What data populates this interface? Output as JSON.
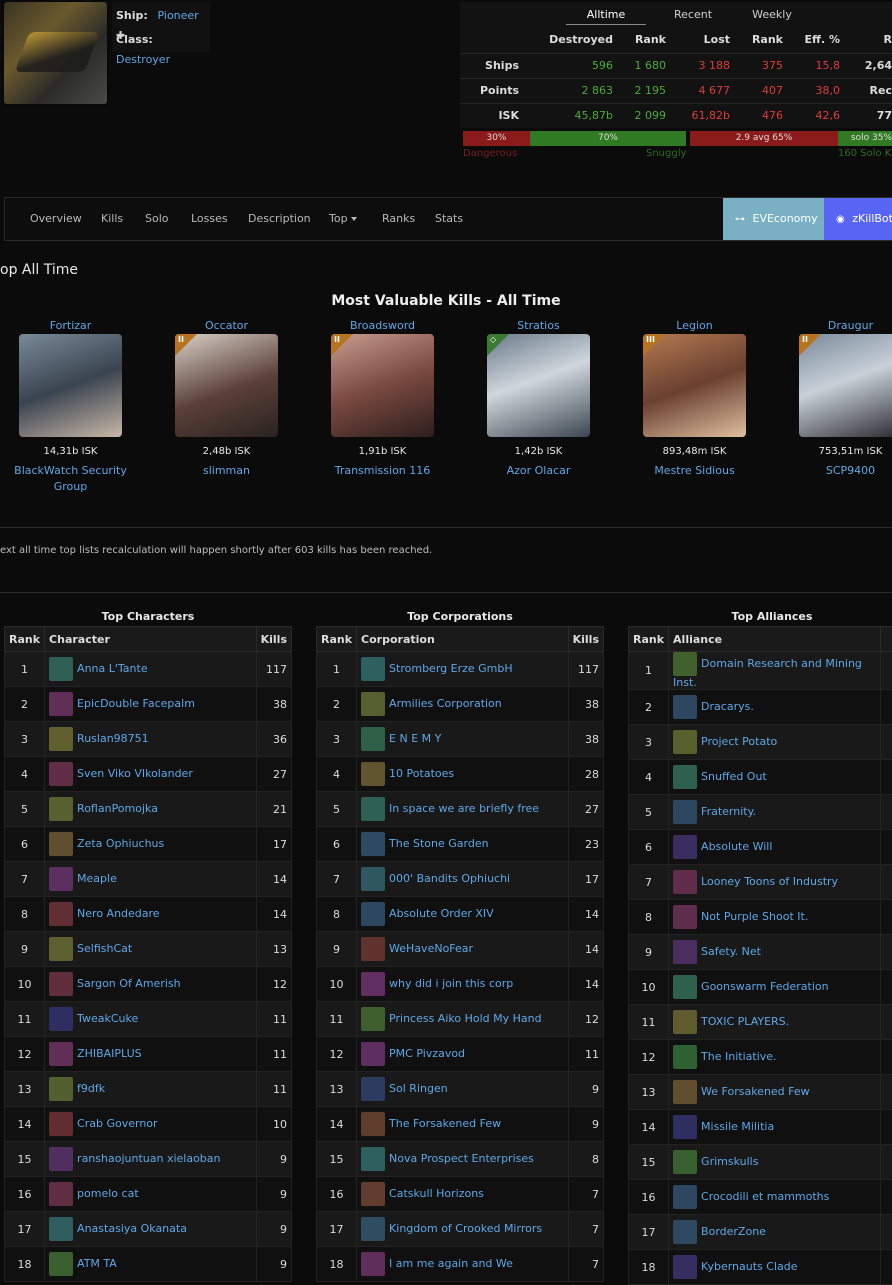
{
  "ship": {
    "label": "Ship:",
    "name": "Pioneer",
    "plus": "✚",
    "class_label": "Class:",
    "class": "Destroyer"
  },
  "stats": {
    "tabs": [
      "Alltime",
      "Recent",
      "Weekly"
    ],
    "headers": [
      "Destroyed",
      "Rank",
      "Lost",
      "Rank",
      "Eff. %",
      "R"
    ],
    "rows": [
      {
        "label": "Ships",
        "destroyed": "596",
        "rank": "1 680",
        "lost": "3 188",
        "lrank": "375",
        "eff": "15,8",
        "extra": "2,64"
      },
      {
        "label": "Points",
        "destroyed": "2 863",
        "rank": "2 195",
        "lost": "4 677",
        "lrank": "407",
        "eff": "38,0",
        "extra": "Rec"
      },
      {
        "label": "ISK",
        "destroyed": "45,87b",
        "rank": "2 099",
        "lost": "61,82b",
        "lrank": "476",
        "eff": "42,6",
        "extra": "77"
      }
    ],
    "bars": {
      "danger_pct": "30%",
      "snuggly_pct": "70%",
      "avg": "2.9 avg 65%",
      "solo": "solo 35%",
      "danger_label": "Dangerous",
      "snuggly_label": "Snuggly",
      "solo_kills": "160 Solo K"
    },
    "bar_levels": {
      "dangerous": 0.3,
      "snuggly": 0.7,
      "gang": 0.65,
      "solo": 0.35
    }
  },
  "nav": {
    "items": [
      "Overview",
      "Kills",
      "Solo",
      "Losses",
      "Description",
      "Top",
      "Ranks",
      "Stats"
    ],
    "eco_label": "EVEconomy",
    "bot_label": "zKillBot"
  },
  "top_title": "op All Time",
  "mvk": {
    "title": "Most Valuable Kills - All Time",
    "kills": [
      {
        "ship": "Fortizar",
        "isk": "14,31b ISK",
        "who": "BlackWatch Security Group",
        "tier": ""
      },
      {
        "ship": "Occator",
        "isk": "2,48b ISK",
        "who": "slimman",
        "tier": "II"
      },
      {
        "ship": "Broadsword",
        "isk": "1,91b ISK",
        "who": "Transmission 116",
        "tier": "II"
      },
      {
        "ship": "Stratios",
        "isk": "1,42b ISK",
        "who": "Azor Olacar",
        "tier": "◇"
      },
      {
        "ship": "Legion",
        "isk": "893,48m ISK",
        "who": "Mestre Sidious",
        "tier": "III"
      },
      {
        "ship": "Draugur",
        "isk": "753,51m ISK",
        "who": "SCP9400",
        "tier": "II"
      }
    ]
  },
  "note": "ext all time top lists recalculation will happen shortly after 603 kills has been reached.",
  "chars": {
    "title": "Top Characters",
    "h_rank": "Rank",
    "h_name": "Character",
    "h_kills": "Kills",
    "rows": [
      {
        "r": "1",
        "n": "Anna L'Tante",
        "k": "117"
      },
      {
        "r": "2",
        "n": "EpicDouble Facepalm",
        "k": "38"
      },
      {
        "r": "3",
        "n": "Ruslan98751",
        "k": "36"
      },
      {
        "r": "4",
        "n": "Sven Viko VIkolander",
        "k": "27"
      },
      {
        "r": "5",
        "n": "RoflanPomojka",
        "k": "21"
      },
      {
        "r": "6",
        "n": "Zeta Ophiuchus",
        "k": "17"
      },
      {
        "r": "7",
        "n": "Meaple",
        "k": "14"
      },
      {
        "r": "8",
        "n": "Nero Andedare",
        "k": "14"
      },
      {
        "r": "9",
        "n": "SelfishCat",
        "k": "13"
      },
      {
        "r": "10",
        "n": "Sargon Of Amerish",
        "k": "12"
      },
      {
        "r": "11",
        "n": "TweakCuke",
        "k": "11"
      },
      {
        "r": "12",
        "n": "ZHIBAIPLUS",
        "k": "11"
      },
      {
        "r": "13",
        "n": "f9dfk",
        "k": "11"
      },
      {
        "r": "14",
        "n": "Crab Governor",
        "k": "10"
      },
      {
        "r": "15",
        "n": "ranshaojuntuan xielaoban",
        "k": "9"
      },
      {
        "r": "16",
        "n": "pomelo cat",
        "k": "9"
      },
      {
        "r": "17",
        "n": "Anastasiya Okanata",
        "k": "9"
      },
      {
        "r": "18",
        "n": "ATM TA",
        "k": "9"
      }
    ]
  },
  "corps": {
    "title": "Top Corporations",
    "h_rank": "Rank",
    "h_name": "Corporation",
    "h_kills": "Kills",
    "rows": [
      {
        "r": "1",
        "n": "Stromberg Erze GmbH",
        "k": "117"
      },
      {
        "r": "2",
        "n": "Armilies Corporation",
        "k": "38"
      },
      {
        "r": "3",
        "n": "E N E M Y",
        "k": "38"
      },
      {
        "r": "4",
        "n": "10 Potatoes",
        "k": "28"
      },
      {
        "r": "5",
        "n": "In space we are briefly free",
        "k": "27"
      },
      {
        "r": "6",
        "n": "The Stone Garden",
        "k": "23"
      },
      {
        "r": "7",
        "n": "000' Bandits Ophiuchi",
        "k": "17"
      },
      {
        "r": "8",
        "n": "Absolute Order XIV",
        "k": "14"
      },
      {
        "r": "9",
        "n": "WeHaveNoFear",
        "k": "14"
      },
      {
        "r": "10",
        "n": "why did i join this corp",
        "k": "14"
      },
      {
        "r": "11",
        "n": "Princess Aiko Hold My Hand",
        "k": "12"
      },
      {
        "r": "12",
        "n": "PMC Pivzavod",
        "k": "11"
      },
      {
        "r": "13",
        "n": "Sol Ringen",
        "k": "9"
      },
      {
        "r": "14",
        "n": "The Forsakened Few",
        "k": "9"
      },
      {
        "r": "15",
        "n": "Nova Prospect Enterprises",
        "k": "8"
      },
      {
        "r": "16",
        "n": "Catskull Horizons",
        "k": "7"
      },
      {
        "r": "17",
        "n": "Kingdom of Crooked Mirrors",
        "k": "7"
      },
      {
        "r": "18",
        "n": "I am me again and We",
        "k": "7"
      }
    ]
  },
  "alliances": {
    "title": "Top Alliances",
    "h_rank": "Rank",
    "h_name": "Alliance",
    "rows": [
      {
        "r": "1",
        "n": "Domain Research and Mining Inst."
      },
      {
        "r": "2",
        "n": "Dracarys."
      },
      {
        "r": "3",
        "n": "Project Potato"
      },
      {
        "r": "4",
        "n": "Snuffed Out"
      },
      {
        "r": "5",
        "n": "Fraternity."
      },
      {
        "r": "6",
        "n": "Absolute Will"
      },
      {
        "r": "7",
        "n": "Looney Toons of Industry"
      },
      {
        "r": "8",
        "n": "Not Purple Shoot It."
      },
      {
        "r": "9",
        "n": "Safety. Net"
      },
      {
        "r": "10",
        "n": "Goonswarm Federation"
      },
      {
        "r": "11",
        "n": "TOXIC PLAYERS."
      },
      {
        "r": "12",
        "n": "The Initiative."
      },
      {
        "r": "13",
        "n": "We Forsakened Few"
      },
      {
        "r": "14",
        "n": "Missile Militia"
      },
      {
        "r": "15",
        "n": "Grimskulls"
      },
      {
        "r": "16",
        "n": "Crocodili et mammoths"
      },
      {
        "r": "17",
        "n": "BorderZone"
      },
      {
        "r": "18",
        "n": "Kybernauts Clade"
      }
    ]
  },
  "colors": {
    "link": "#5fa7e6",
    "green": "#4caa3a",
    "red": "#e03b3b",
    "eco": "#79b0c3",
    "bot": "#5865f2"
  }
}
